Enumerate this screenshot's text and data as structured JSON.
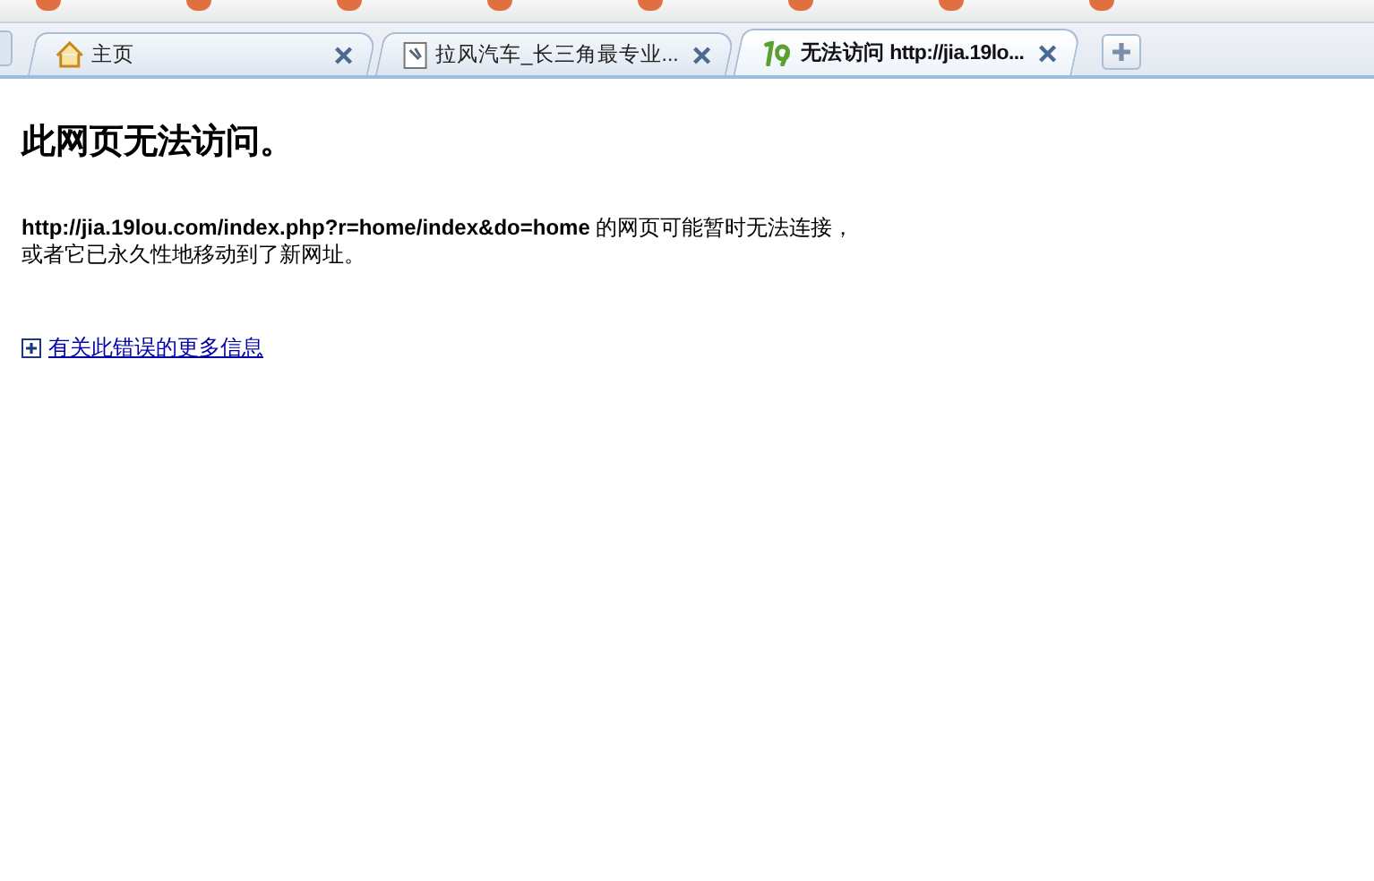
{
  "tabs": [
    {
      "label": "主页",
      "kind": "home",
      "selected": false
    },
    {
      "label": "拉风汽车_长三角最专业...",
      "kind": "page",
      "selected": false
    },
    {
      "label": "无法访问 http://jia.19lo...",
      "kind": "site",
      "selected": true
    }
  ],
  "error_page": {
    "heading": "此网页无法访问。",
    "message": "**http://jia.19lou.com/index.php?r=home/index&do=home** 的网页可能暂时无法连接，或者它已永久性地移动到了新网址。",
    "more_info_link": "有关此错误的更多信息",
    "expanded": false
  }
}
